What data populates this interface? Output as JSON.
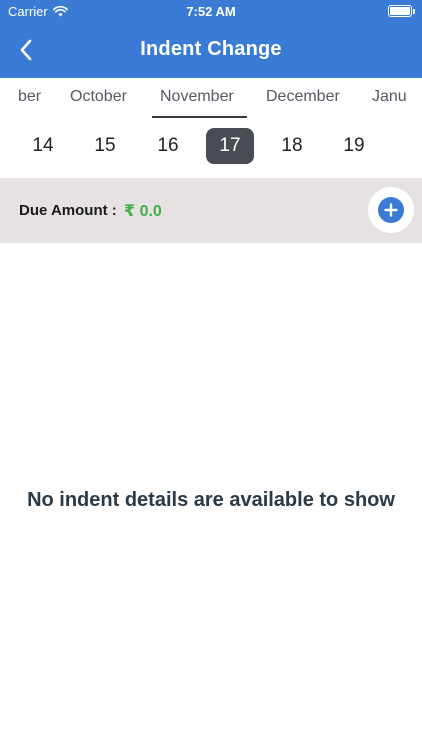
{
  "status_bar": {
    "carrier": "Carrier",
    "time": "7:52 AM"
  },
  "header": {
    "title": "Indent Change",
    "back_icon": "chevron-left-icon"
  },
  "months": [
    {
      "label": "ber"
    },
    {
      "label": "October"
    },
    {
      "label": "November",
      "selected": true
    },
    {
      "label": "December"
    },
    {
      "label": "Janu"
    }
  ],
  "days": [
    {
      "label": "14"
    },
    {
      "label": "15"
    },
    {
      "label": "16"
    },
    {
      "label": "17",
      "selected": true
    },
    {
      "label": "18"
    },
    {
      "label": "19"
    }
  ],
  "due": {
    "label": "Due Amount :",
    "value": "₹ 0.0",
    "value_color": "#3dae4a"
  },
  "add_icon": "plus-circle-icon",
  "empty_message": "No indent details are available to show",
  "colors": {
    "header": "#3a7bd5",
    "due_bar": "#e6e2e1",
    "selected_day": "#4a4c54"
  }
}
